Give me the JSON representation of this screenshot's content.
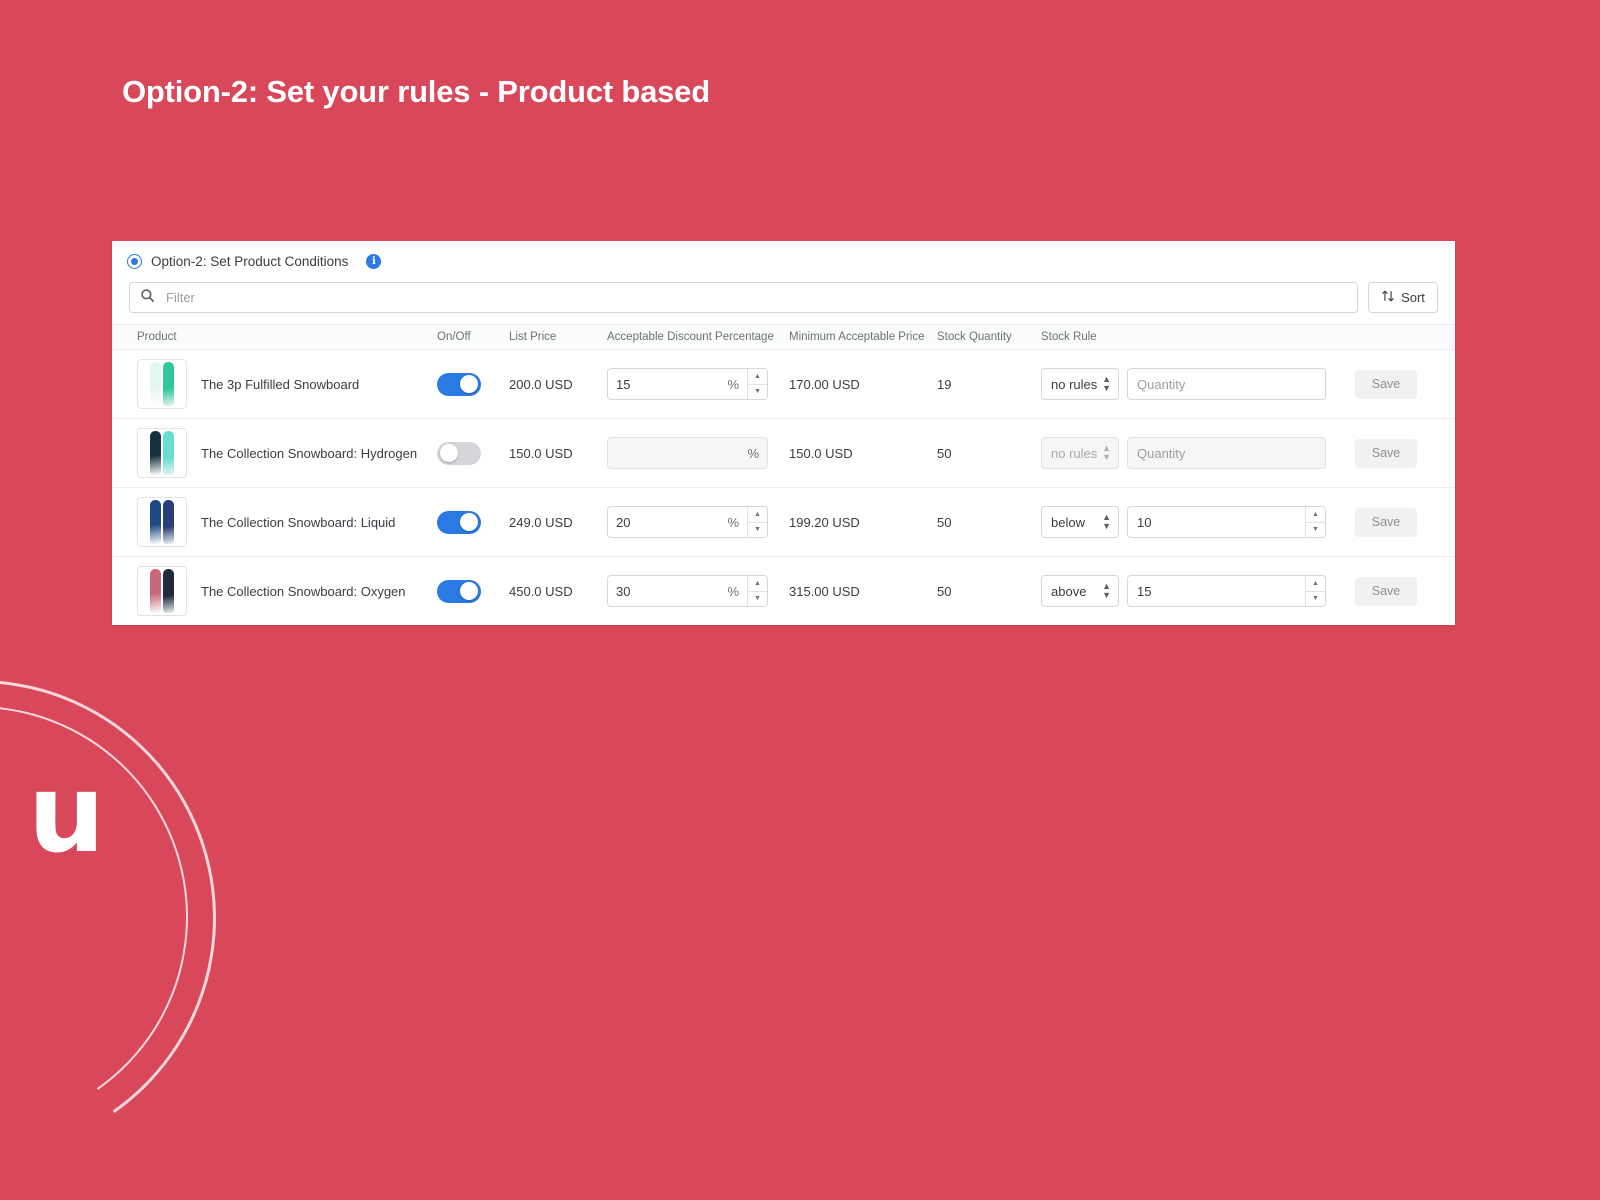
{
  "slide": {
    "title": "Option-2: Set your rules - Product based",
    "background_color": "#d9485a",
    "logo_letter": "u"
  },
  "card": {
    "header": {
      "radio_label": "Option-2: Set Product Conditions",
      "radio_selected": true,
      "info_icon": "info-icon",
      "accent_color": "#2b7ae4"
    },
    "filter": {
      "placeholder": "Filter",
      "value": "",
      "icon": "search-icon"
    },
    "sort_button": {
      "label": "Sort",
      "icon": "sort-arrows-icon"
    },
    "columns": [
      "Product",
      "On/Off",
      "List Price",
      "Acceptable Discount Percentage",
      "Minimum Acceptable Price",
      "Stock Quantity",
      "Stock Rule",
      ""
    ],
    "percent_sign": "%",
    "quantity_placeholder": "Quantity",
    "save_label": "Save",
    "rows": [
      {
        "product_name": "The 3p Fulfilled Snowboard",
        "enabled": true,
        "list_price": "200.0 USD",
        "discount_percentage": "15",
        "minimum_acceptable_price": "170.00 USD",
        "stock_quantity": "19",
        "stock_rule": "no rules",
        "stock_rule_quantity": "",
        "save_label": "Save",
        "thumb_colors": [
          "#e3f7ee",
          "#2fc79b"
        ]
      },
      {
        "product_name": "The Collection Snowboard: Hydrogen",
        "enabled": false,
        "list_price": "150.0 USD",
        "discount_percentage": "",
        "minimum_acceptable_price": "150.0 USD",
        "stock_quantity": "50",
        "stock_rule": "no rules",
        "stock_rule_quantity": "",
        "save_label": "Save",
        "thumb_colors": [
          "#15313b",
          "#67ded0"
        ]
      },
      {
        "product_name": "The Collection Snowboard: Liquid",
        "enabled": true,
        "list_price": "249.0 USD",
        "discount_percentage": "20",
        "minimum_acceptable_price": "199.20 USD",
        "stock_quantity": "50",
        "stock_rule": "below",
        "stock_rule_quantity": "10",
        "save_label": "Save",
        "thumb_colors": [
          "#1b4a80",
          "#2c3d78"
        ]
      },
      {
        "product_name": "The Collection Snowboard: Oxygen",
        "enabled": true,
        "list_price": "450.0 USD",
        "discount_percentage": "30",
        "minimum_acceptable_price": "315.00 USD",
        "stock_quantity": "50",
        "stock_rule": "above",
        "stock_rule_quantity": "15",
        "save_label": "Save",
        "thumb_colors": [
          "#c8697a",
          "#23293d"
        ]
      }
    ]
  }
}
